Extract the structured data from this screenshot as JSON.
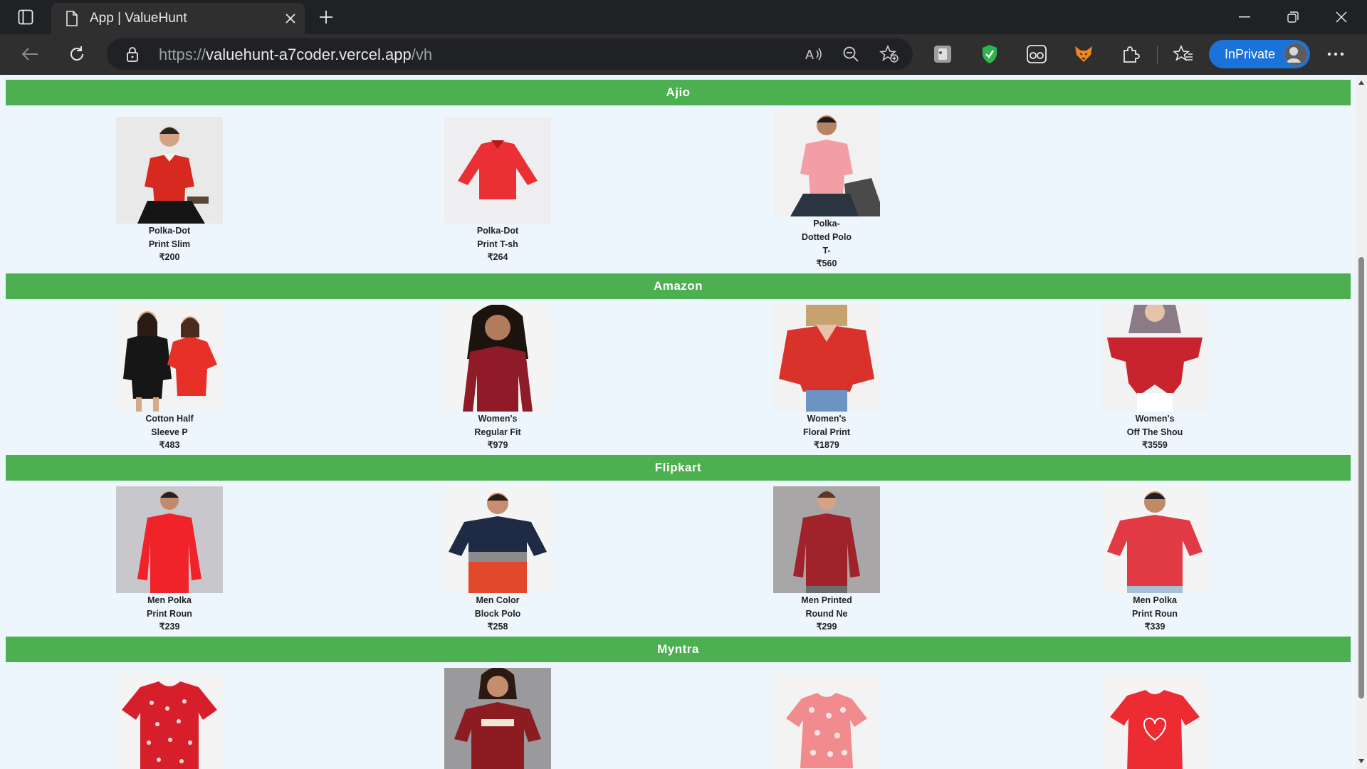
{
  "browser": {
    "tab_title": "App | ValueHunt",
    "url_scheme": "https://",
    "url_host": "valuehunt-a7coder.vercel.app",
    "url_path": "/vh",
    "inprivate_label": "InPrivate"
  },
  "colors": {
    "section_header": "#4caf50",
    "page_bg": "#eef6fd",
    "inprivate": "#1a73d9"
  },
  "sections": [
    {
      "title": "Ajio",
      "products": [
        {
          "name_line1": "Polka-Dot",
          "name_line2": "Print Slim",
          "name_line3": "",
          "name_line4": "",
          "price": "₹200",
          "image": "man-red-polo"
        },
        {
          "name_line1": "Polka-Dot",
          "name_line2": "Print T-sh",
          "name_line3": "",
          "name_line4": "",
          "price": "₹264",
          "image": "red-shirt-flat"
        },
        {
          "name_line1": "Polka-",
          "name_line2": "Dotted Polo",
          "name_line3": "T-",
          "name_line4": "",
          "price": "₹560",
          "image": "man-pink-polo"
        }
      ]
    },
    {
      "title": "Amazon",
      "products": [
        {
          "name_line1": "Cotton Half",
          "name_line2": "Sleeve P",
          "price": "₹483",
          "image": "two-women-tees"
        },
        {
          "name_line1": "Women's",
          "name_line2": "Regular Fit",
          "price": "₹979",
          "image": "woman-maroon-top"
        },
        {
          "name_line1": "Women's",
          "name_line2": "Floral Print",
          "price": "₹1879",
          "image": "woman-floral-blouse"
        },
        {
          "name_line1": "Women's",
          "name_line2": "Off The Shou",
          "price": "₹3559",
          "image": "woman-offshoulder-top"
        }
      ]
    },
    {
      "title": "Flipkart",
      "products": [
        {
          "name_line1": "Men Polka",
          "name_line2": "Print Roun",
          "price": "₹239",
          "image": "man-red-fullsleeve"
        },
        {
          "name_line1": "Men Color",
          "name_line2": "Block Polo",
          "price": "₹258",
          "image": "man-colorblock-polo"
        },
        {
          "name_line1": "Men Printed",
          "name_line2": "Round Ne",
          "price": "₹299",
          "image": "man-printed-tee"
        },
        {
          "name_line1": "Men Polka",
          "name_line2": "Print Roun",
          "price": "₹339",
          "image": "man-red-tee"
        }
      ]
    },
    {
      "title": "Myntra",
      "products": [
        {
          "image": "red-heart-tee"
        },
        {
          "image": "woman-amour-tee"
        },
        {
          "image": "pink-dotted-tee"
        },
        {
          "image": "red-love-tee"
        }
      ]
    }
  ]
}
